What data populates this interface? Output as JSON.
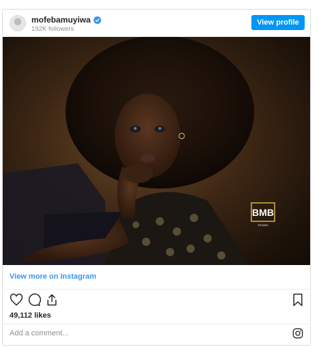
{
  "header": {
    "username": "mofebamuyiwa",
    "followers": "192K followers",
    "view_profile_label": "View profile"
  },
  "post": {
    "image_label": "BMB",
    "image_sublabel": "STUDIO",
    "view_more_label": "View more on Instagram",
    "likes": "49,112 likes",
    "comment_placeholder": "Add a comment..."
  },
  "icons": {
    "verified": "verified-badge-icon",
    "like": "heart-icon",
    "comment": "comment-icon",
    "share": "share-icon",
    "save": "bookmark-icon",
    "instagram": "instagram-icon"
  },
  "colors": {
    "accent": "#0095f6",
    "link": "#3897f0",
    "muted": "#8e8e8e",
    "text": "#262626"
  }
}
